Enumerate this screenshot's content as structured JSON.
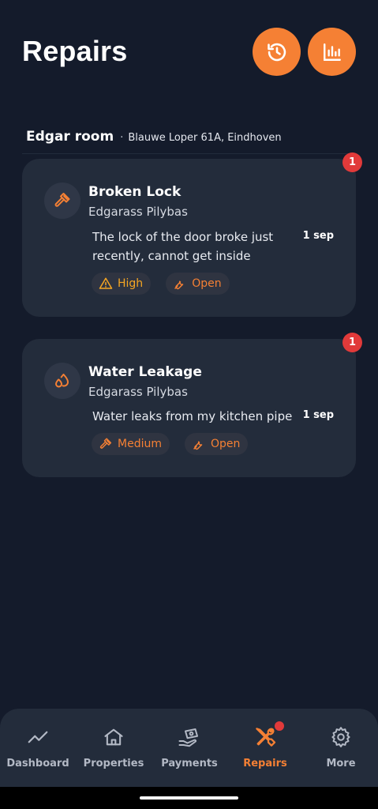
{
  "header": {
    "title": "Repairs",
    "history_icon": "history-icon",
    "stats_icon": "bar-chart-icon",
    "accent": "#f58034"
  },
  "property": {
    "name": "Edgar room",
    "separator": "·",
    "address": "Blauwe Loper 61A, Eindhoven"
  },
  "repairs": [
    {
      "badge": "1",
      "icon": "hammer-icon",
      "title": "Broken Lock",
      "user": "Edgarass Pilybas",
      "description": "The lock of the door broke just recently, cannot get inside",
      "date": "1 sep",
      "priority": "High",
      "priority_icon": "warning-icon",
      "status": "Open",
      "status_icon": "wrench-icon"
    },
    {
      "badge": "1",
      "icon": "water-drops-icon",
      "title": "Water Leakage",
      "user": "Edgarass Pilybas",
      "description": "Water leaks from my kitchen pipe",
      "date": "1 sep",
      "priority": "Medium",
      "priority_icon": "hammer-icon",
      "status": "Open",
      "status_icon": "wrench-icon"
    }
  ],
  "nav": {
    "items": [
      {
        "label": "Dashboard",
        "icon": "trend-line-icon"
      },
      {
        "label": "Properties",
        "icon": "home-icon"
      },
      {
        "label": "Payments",
        "icon": "payment-hand-icon"
      },
      {
        "label": "Repairs",
        "icon": "tools-icon",
        "active": true
      },
      {
        "label": "More",
        "icon": "gear-icon"
      }
    ]
  },
  "colors": {
    "background": "#141b2b",
    "card": "#232c3b",
    "badge": "#e13a3a",
    "high": "#f5a623"
  }
}
